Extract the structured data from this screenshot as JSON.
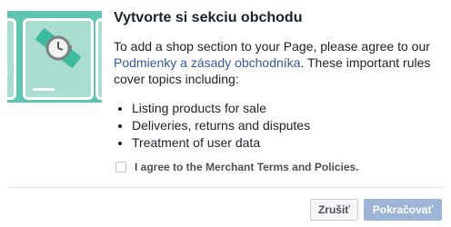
{
  "dialog": {
    "title": "Vytvorte si sekciu obchodu",
    "intro_before_link": "To add a shop section to your Page, please agree to our ",
    "link_text": "Podmienky a zásady obchodníka",
    "intro_after_link": ". These important rules cover topics including:",
    "rules": [
      "Listing products for sale",
      "Deliveries, returns and disputes",
      "Treatment of user data"
    ],
    "agree_label": "I agree to the Merchant Terms and Policies.",
    "agree_checked": false
  },
  "buttons": {
    "cancel_label": "Zrušiť",
    "continue_label": "Pokračovať"
  },
  "illustration": {
    "icon": "watch-icon",
    "background_color": "#5fc4b0",
    "card_color": "#a8ddd0"
  },
  "colors": {
    "link": "#365899",
    "primary_disabled": "#9cb4d8"
  }
}
